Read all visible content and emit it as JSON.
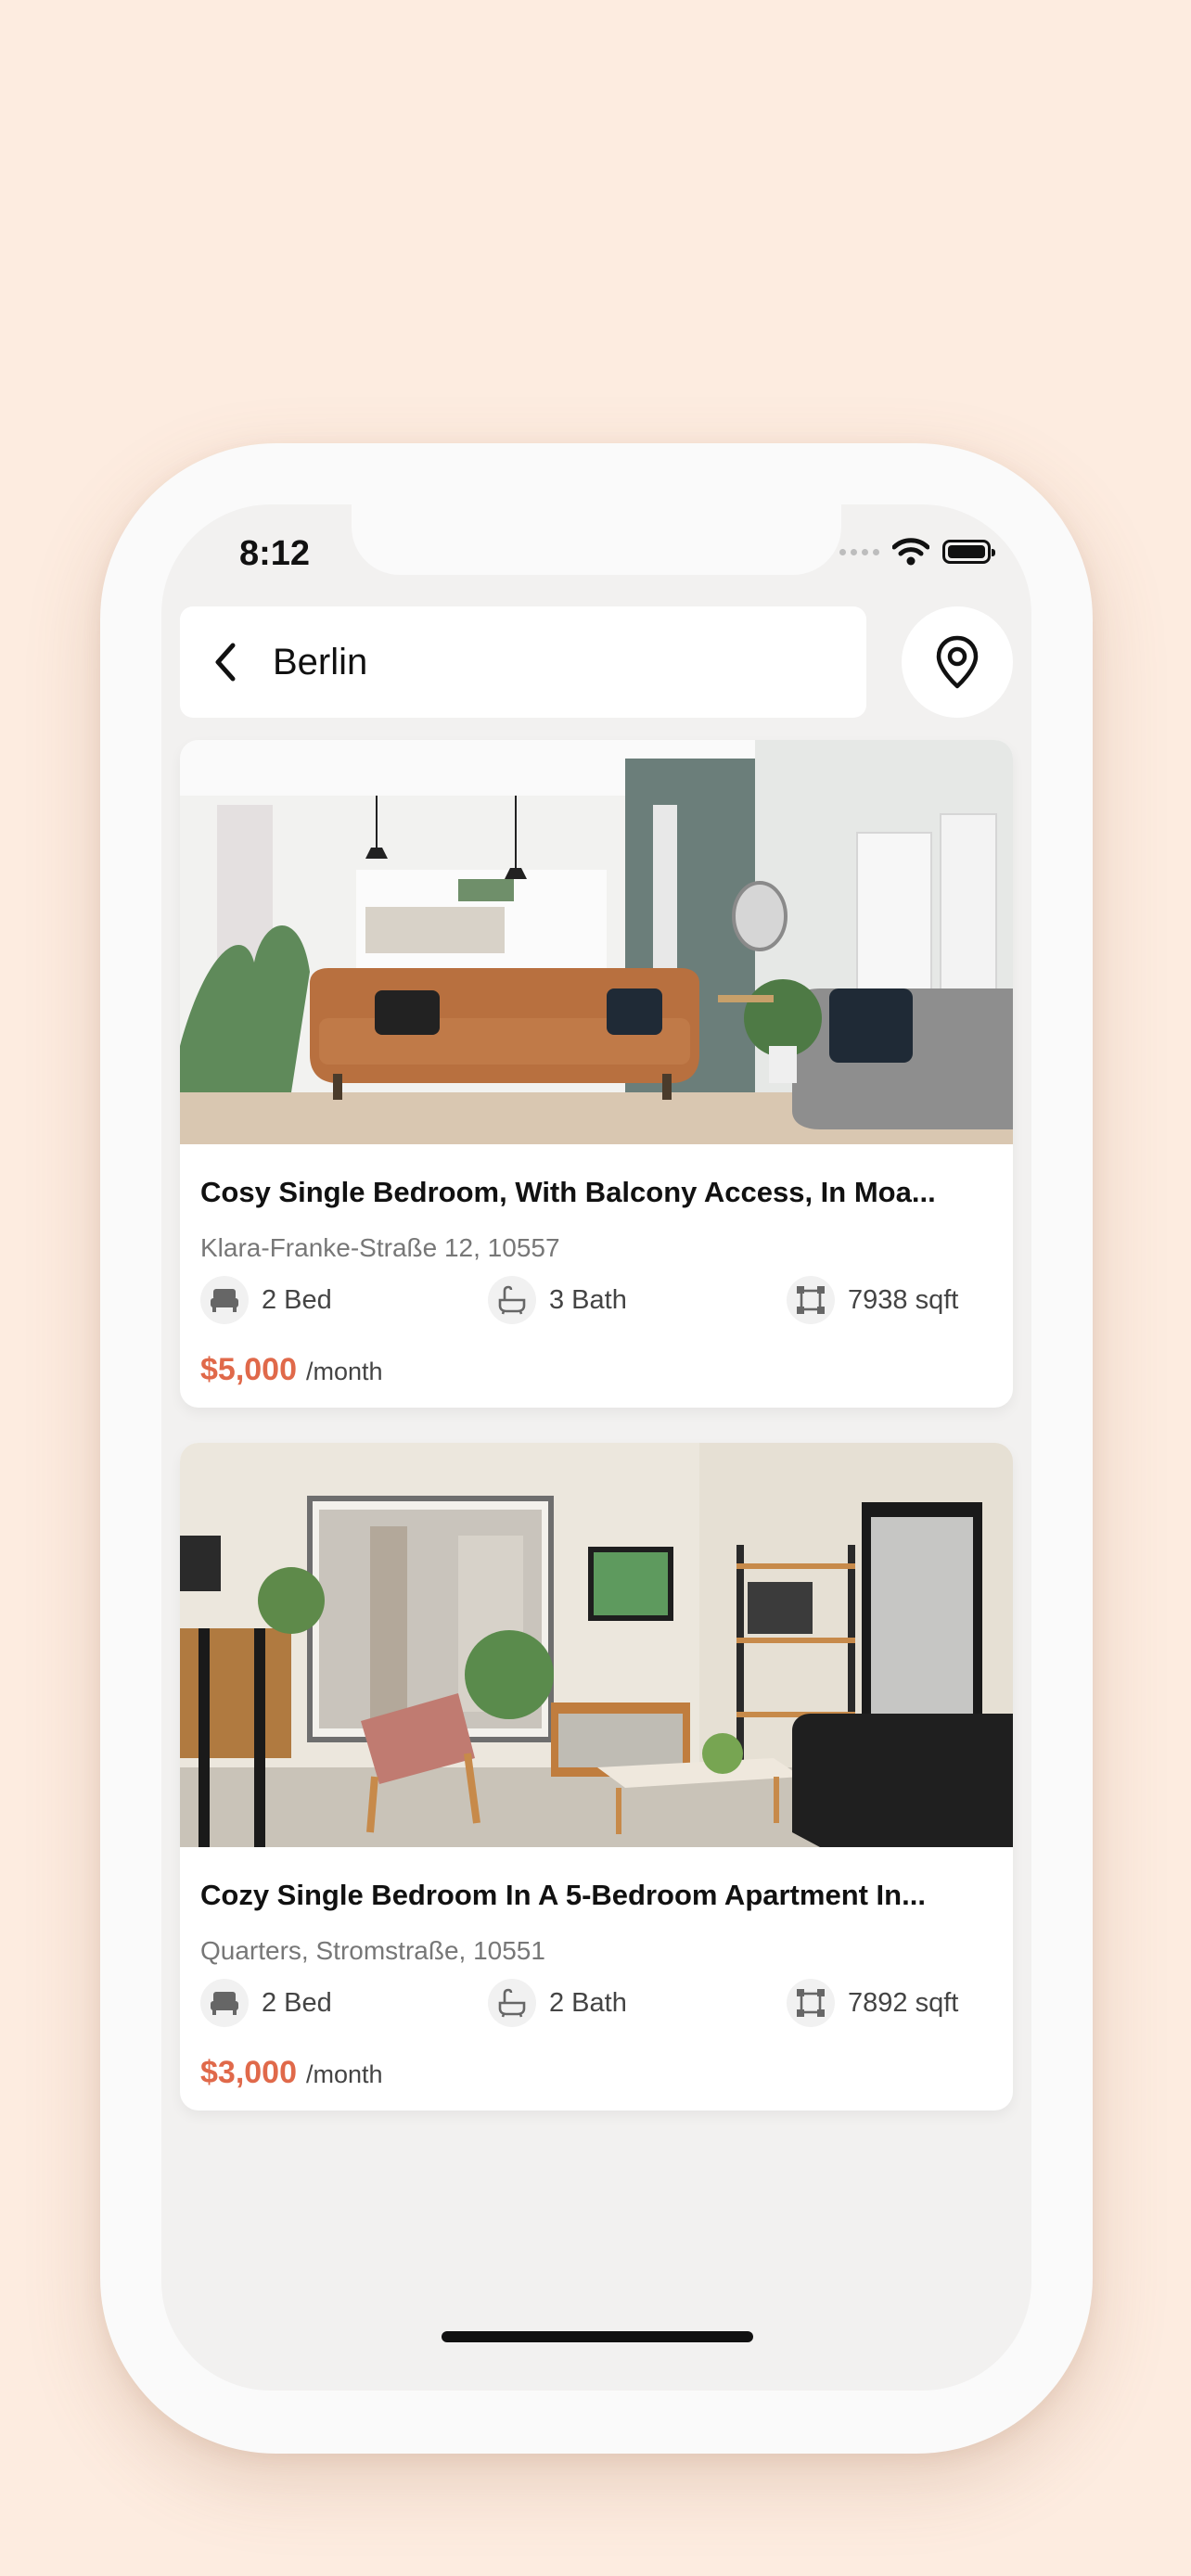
{
  "status_bar": {
    "time": "8:12"
  },
  "search": {
    "value": "Berlin"
  },
  "colors": {
    "price": "#e0694a",
    "background": "#fdece0"
  },
  "icons": {
    "back": "chevron-left-icon",
    "location": "map-pin-icon",
    "bed": "bed-icon",
    "bath": "bathtub-icon",
    "area": "area-frame-icon"
  },
  "listings": [
    {
      "title": "Cosy Single Bedroom, With Balcony Access, In Moa...",
      "address": "Klara-Franke-Straße 12, 10557",
      "beds": "2 Bed",
      "baths": "3 Bath",
      "area": "7938 sqft",
      "price": "$5,000",
      "period": "/month"
    },
    {
      "title": "Cozy Single Bedroom In A 5-Bedroom Apartment In...",
      "address": "Quarters, Stromstraße, 10551",
      "beds": "2 Bed",
      "baths": "2 Bath",
      "area": "7892 sqft",
      "price": "$3,000",
      "period": "/month"
    }
  ]
}
